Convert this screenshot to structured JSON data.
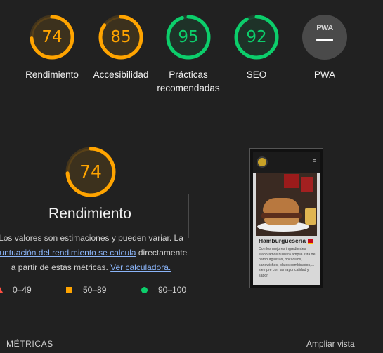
{
  "colors": {
    "average": "#ffa400",
    "pass": "#0cce6b",
    "fail": "#ff4e42",
    "link": "#8ab4f8"
  },
  "scores": [
    {
      "value": "74",
      "percent": 74,
      "label": "Rendimiento",
      "rating": "average"
    },
    {
      "value": "85",
      "percent": 85,
      "label": "Accesibilidad",
      "rating": "average"
    },
    {
      "value": "95",
      "percent": 95,
      "label": "Prácticas recomendadas",
      "rating": "pass"
    },
    {
      "value": "92",
      "percent": 92,
      "label": "SEO",
      "rating": "pass"
    }
  ],
  "pwa": {
    "badge": "PWA",
    "label": "PWA"
  },
  "performance": {
    "score": "74",
    "percent": 74,
    "title": "Rendimiento",
    "desc_part1": "Los valores son estimaciones y pueden variar. La ",
    "desc_link1": "puntuación del rendimiento se calcula",
    "desc_part2": " directamente a partir de estas métricas. ",
    "desc_link2": "Ver calculadora."
  },
  "legend": [
    {
      "shape": "triangle",
      "range": "0–49"
    },
    {
      "shape": "square",
      "range": "50–89"
    },
    {
      "shape": "circle",
      "range": "90–100"
    }
  ],
  "screenshot": {
    "menu_icon": "hamburger-menu-icon",
    "title": "Hamburguesería",
    "text": "Con los mejores ingredientes elaboramos nuestra amplia lista de hamburguesas, bocadillos, sandwiches, platos combinados,... siempre con la mayor calidad y sabor"
  },
  "footer": {
    "metrics": "MÉTRICAS",
    "expand": "Ampliar vista"
  }
}
